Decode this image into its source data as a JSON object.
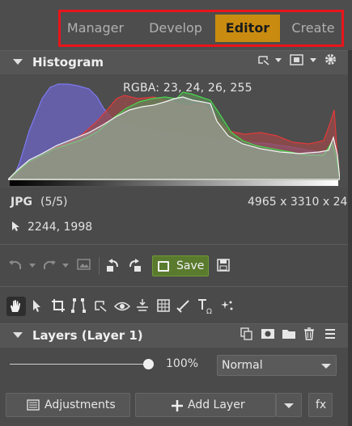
{
  "tabs": [
    {
      "label": "Manager",
      "active": false
    },
    {
      "label": "Develop",
      "active": false
    },
    {
      "label": "Editor",
      "active": true
    },
    {
      "label": "Create",
      "active": false
    }
  ],
  "colors": {
    "accent": "#c98c10",
    "highlight_border": "#e8151b",
    "save_green": "#5a7a2e",
    "panel_bg": "#4a4a4a"
  },
  "histogram": {
    "title": "Histogram",
    "rgba_readout": "RGBA:  23,  24,  26, 255",
    "file_format": "JPG",
    "file_index": "(5/5)",
    "dimensions": "4965 x 3310 x 24",
    "cursor_position": "2244, 1998"
  },
  "toolbar": {
    "save_label": "Save"
  },
  "layers": {
    "title": "Layers (Layer 1)",
    "opacity": "100%",
    "opacity_value": 100,
    "blend_mode": "Normal"
  },
  "bottom": {
    "adjustments_label": "Adjustments",
    "add_layer_label": "Add Layer",
    "fx_label": "fx"
  },
  "icons": [
    "collapse-triangle-icon",
    "pin-icon",
    "square-icon",
    "gear-icon",
    "undo-icon",
    "redo-icon",
    "image-icon",
    "rotate-left-icon",
    "rotate-right-icon",
    "save-disk-icon",
    "hand-icon",
    "pointer-icon",
    "crop-icon",
    "perspective-icon",
    "transform-icon",
    "eye-icon",
    "straighten-icon",
    "grid-icon",
    "brush-icon",
    "text-icon",
    "sparkle-icon",
    "duplicate-icon",
    "mask-icon",
    "folder-icon",
    "trash-icon",
    "menu-icon",
    "cursor-icon",
    "adjustments-icon",
    "plus-icon"
  ]
}
